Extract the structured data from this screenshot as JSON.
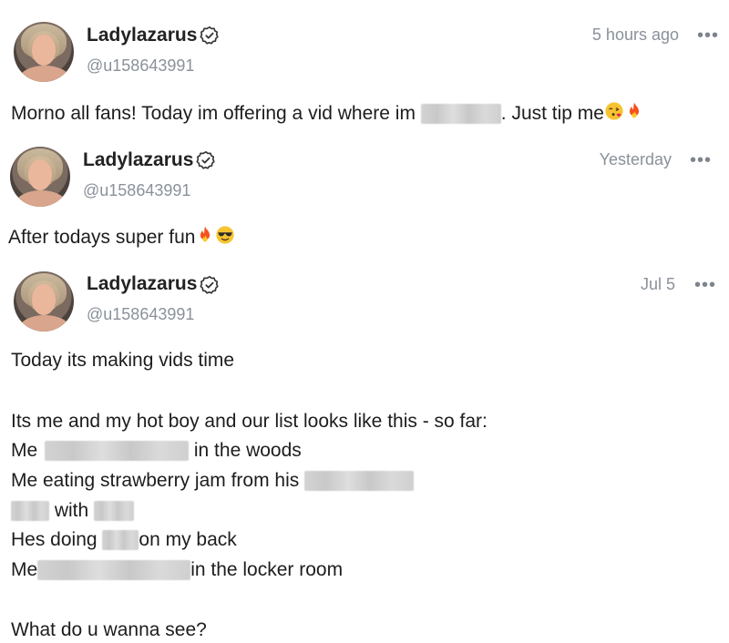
{
  "posts": [
    {
      "name": "Ladylazarus",
      "handle": "@u158643991",
      "time": "5 hours ago",
      "more": "•••",
      "text_before": "Morno all fans! Today im offering a vid where im",
      "text_after": ". Just tip me"
    },
    {
      "name": "Ladylazarus",
      "handle": "@u158643991",
      "time": "Yesterday",
      "more": "•••",
      "text": "After todays super fun"
    },
    {
      "name": "Ladylazarus",
      "handle": "@u158643991",
      "time": "Jul 5",
      "more": "•••",
      "lines": {
        "l1": "Today its making vids time",
        "l2": "Its me and my hot boy and our list looks like this - so far:",
        "l3a": "Me",
        "l3b": "in the woods",
        "l4a": "Me eating strawberry jam from his",
        "l5a": "with",
        "l6a": "Hes doing",
        "l6b": "on my back",
        "l7a": "Me",
        "l7b": "in the locker room",
        "l8": "What do u wanna see?"
      }
    }
  ],
  "icons": {
    "verified": "verified-badge-icon",
    "more": "more-options-icon",
    "kiss": "face-blowing-kiss-emoji",
    "fire": "fire-emoji",
    "sunglasses": "smiling-face-with-sunglasses-emoji"
  },
  "colors": {
    "name": "#222222",
    "muted": "#8a919a",
    "text": "#1d1d1d"
  }
}
